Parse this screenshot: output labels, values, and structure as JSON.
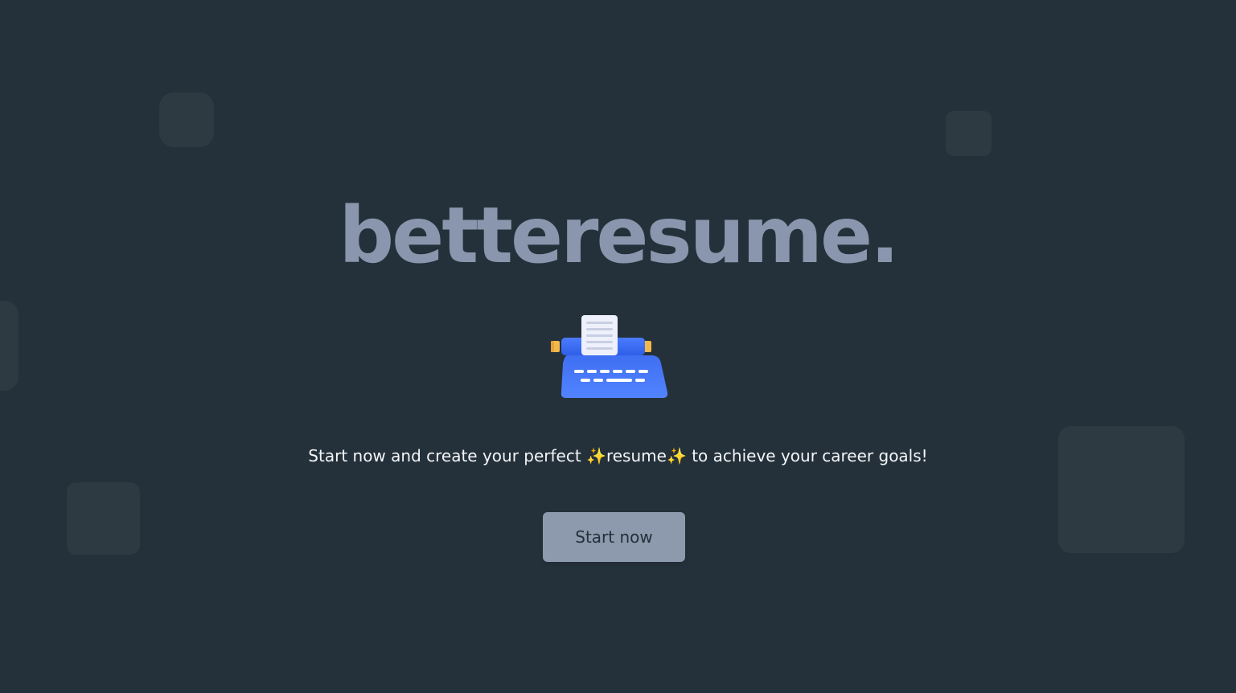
{
  "brand": {
    "title": "betteresume."
  },
  "hero": {
    "illustration_icon": "typewriter-icon",
    "tagline": {
      "before": "Start now and create your perfect ",
      "sparkle_left": "✨",
      "highlight": "resume",
      "sparkle_right": "✨",
      "after": " to achieve your career goals!"
    },
    "cta_label": "Start now"
  },
  "colors": {
    "background": "#25313a",
    "decor_tile": "#2e3a41",
    "brand_text": "#8996ad",
    "button_bg": "#8d99ad",
    "typewriter_blue": "#3b6ff5"
  }
}
